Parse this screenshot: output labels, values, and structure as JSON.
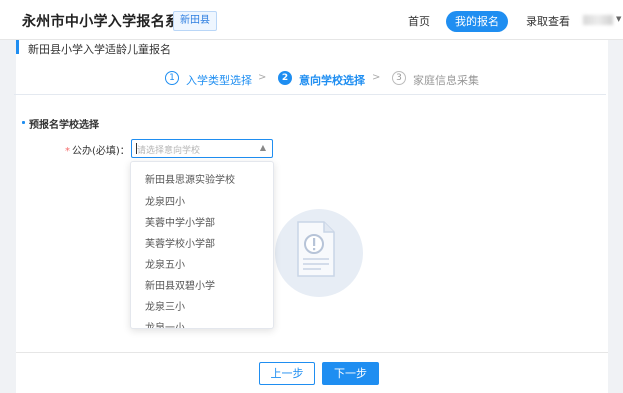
{
  "header": {
    "system_title": "永州市中小学入学报名系统",
    "county": "新田县",
    "nav": {
      "home": "首页",
      "my_signup": "我的报名",
      "result_query": "录取查看"
    }
  },
  "panel": {
    "title": "新田县小学入学适龄儿童报名"
  },
  "steps": [
    {
      "num": "1",
      "label": "入学类型选择",
      "state": "done"
    },
    {
      "num": "2",
      "label": "意向学校选择",
      "state": "active"
    },
    {
      "num": "3",
      "label": "家庭信息采集",
      "state": "todo"
    }
  ],
  "section": {
    "title": "预报名学校选择"
  },
  "form": {
    "required_mark": "*",
    "public_label": "公办(必填)：",
    "public_placeholder": "请选择意向学校"
  },
  "dropdown": {
    "options": [
      "新田县思源实验学校",
      "龙泉四小",
      "芙蓉中学小学部",
      "芙蓉学校小学部",
      "龙泉五小",
      "新田县双碧小学",
      "龙泉三小",
      "龙泉一小"
    ]
  },
  "buttons": {
    "prev": "上一步",
    "next": "下一步"
  },
  "colors": {
    "primary": "#1f8ef1",
    "required": "#f56c6c"
  }
}
